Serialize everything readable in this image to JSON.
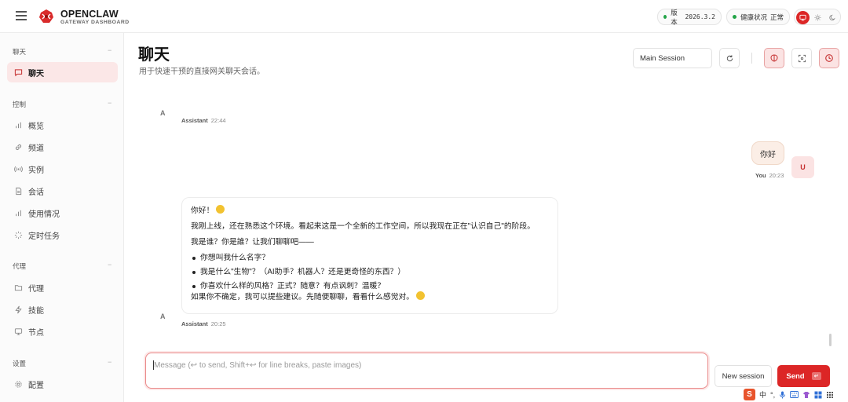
{
  "header": {
    "brand_title": "OPENCLAW",
    "brand_subtitle": "GATEWAY DASHBOARD",
    "version_label": "版本",
    "version_value": "2026.3.2",
    "health_label": "健康状况",
    "health_value": "正常",
    "accent_color": "#dc2626",
    "status_color": "#22a447"
  },
  "sidebar": {
    "sections": [
      {
        "title": "聊天",
        "items": [
          {
            "label": "聊天",
            "icon": "chat-icon",
            "active": true
          }
        ]
      },
      {
        "title": "控制",
        "items": [
          {
            "label": "概览",
            "icon": "bar-chart-icon"
          },
          {
            "label": "频道",
            "icon": "link-icon"
          },
          {
            "label": "实例",
            "icon": "broadcast-icon"
          },
          {
            "label": "会话",
            "icon": "document-icon"
          },
          {
            "label": "使用情况",
            "icon": "bar-chart-icon"
          },
          {
            "label": "定时任务",
            "icon": "loader-icon"
          }
        ]
      },
      {
        "title": "代理",
        "items": [
          {
            "label": "代理",
            "icon": "folder-icon"
          },
          {
            "label": "技能",
            "icon": "bolt-icon"
          },
          {
            "label": "节点",
            "icon": "monitor-icon"
          }
        ]
      },
      {
        "title": "设置",
        "items": [
          {
            "label": "配置",
            "icon": "gear-icon"
          }
        ]
      }
    ],
    "collapse_glyph": "−"
  },
  "main": {
    "title": "聊天",
    "subtitle": "用于快速干预的直接网关聊天会话。",
    "session_select": "Main Session"
  },
  "chat": {
    "messages": [
      {
        "role": "assistant",
        "avatar": "A",
        "sender": "Assistant",
        "time": "22:44"
      },
      {
        "role": "user",
        "avatar": "U",
        "sender": "You",
        "time": "20:23",
        "text": "你好"
      },
      {
        "role": "assistant",
        "avatar": "A",
        "sender": "Assistant",
        "time": "20:25",
        "greeting": "你好！",
        "p1": "我刚上线，还在熟悉这个环境。看起来这是一个全新的工作空间，所以我现在正在\"认识自己\"的阶段。",
        "p2": "我是谁？你是誰？让我们聊聊吧——",
        "bullets": [
          "你想叫我什么名字？",
          "我是什么\"生物\"？（AI助手？机器人？还是更奇怪的东西？）",
          "你喜欢什么样的风格？正式？随意？有点讽刺？温暖？"
        ],
        "closing": "如果你不确定，我可以提些建议。先随便聊聊，看看什么感觉对。"
      }
    ]
  },
  "composer": {
    "placeholder": "Message (↩ to send, Shift+↩ for line breaks, paste images)",
    "new_session_label": "New session",
    "send_label": "Send",
    "send_kbd": "↵"
  },
  "ime": {
    "logo": "S",
    "lang": "中",
    "punct": "°,"
  }
}
